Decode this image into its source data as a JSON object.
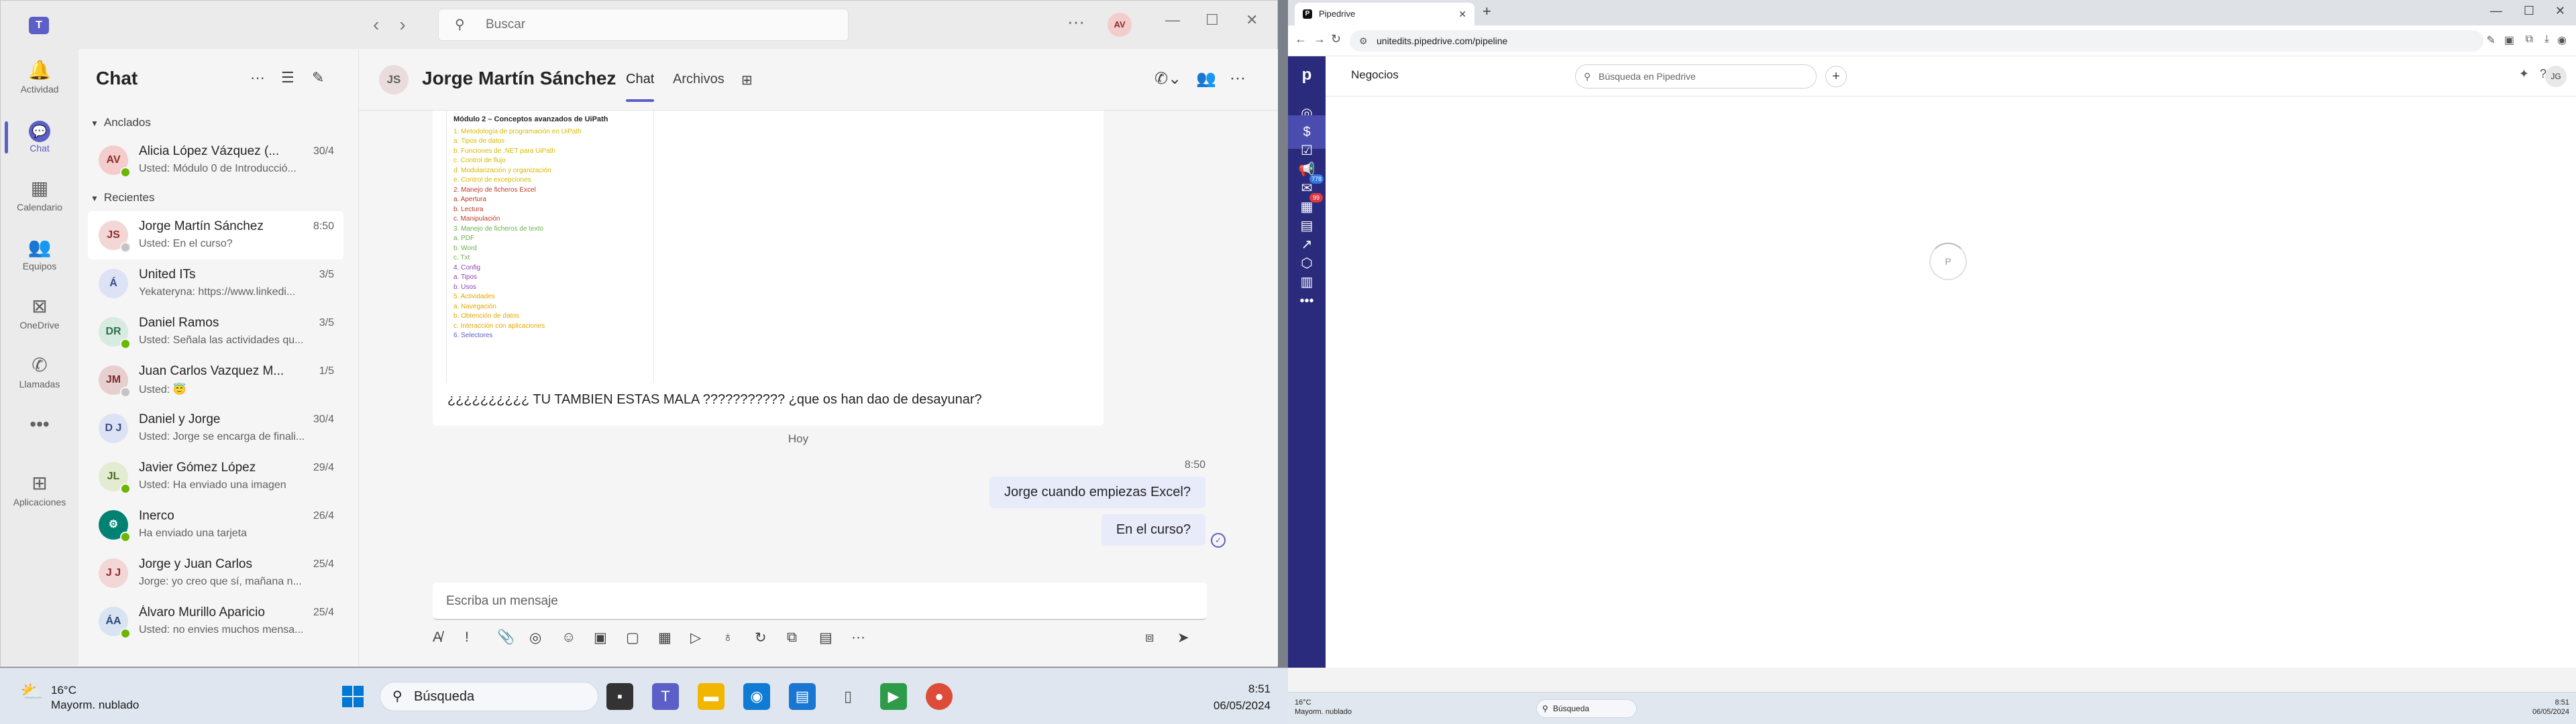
{
  "teams": {
    "search_placeholder": "Buscar",
    "user_initials": "AV",
    "rail": [
      {
        "label": "Actividad",
        "icon": "bell-icon",
        "glyph": "🔔"
      },
      {
        "label": "Chat",
        "icon": "chat-icon",
        "glyph": "💬"
      },
      {
        "label": "Calendario",
        "icon": "calendar-icon",
        "glyph": "▦"
      },
      {
        "label": "Equipos",
        "icon": "teams-icon",
        "glyph": "👥"
      },
      {
        "label": "OneDrive",
        "icon": "onedrive-icon",
        "glyph": "⊠"
      },
      {
        "label": "Llamadas",
        "icon": "phone-icon",
        "glyph": "✆"
      },
      {
        "label": "",
        "icon": "more-icon",
        "glyph": "•••"
      },
      {
        "label": "Aplicaciones",
        "icon": "apps-icon",
        "glyph": "⊞"
      }
    ],
    "chat_title": "Chat",
    "pinned_label": "Anclados",
    "recent_label": "Recientes",
    "pinned": [
      {
        "initials": "AV",
        "name": "Alicia López Vázquez (...",
        "date": "30/4",
        "preview": "Usted: Módulo 0 de Introducció...",
        "avatar_bg": "#f4cccc",
        "avatar_fg": "#8a2b2b",
        "status": "#6bb700"
      }
    ],
    "recent": [
      {
        "initials": "JS",
        "name": "Jorge Martín Sánchez",
        "date": "8:50",
        "preview": "Usted: En el curso?",
        "avatar_bg": "#f3d6d6",
        "avatar_fg": "#8a2b2b",
        "status": "#c4c4c4",
        "selected": true
      },
      {
        "initials": "Á",
        "name": "United ITs",
        "date": "3/5",
        "preview": "Yekateryna: https://www.linkedi...",
        "avatar_bg": "#dde3f5",
        "avatar_fg": "#3a4a8a",
        "status": ""
      },
      {
        "initials": "DR",
        "name": "Daniel Ramos",
        "date": "3/5",
        "preview": "Usted: Señala las actividades qu...",
        "avatar_bg": "#d7ebe1",
        "avatar_fg": "#2f6f4a",
        "status": "#6bb700"
      },
      {
        "initials": "JM",
        "name": "Juan Carlos Vazquez M...",
        "date": "1/5",
        "preview": "Usted: 😇",
        "avatar_bg": "#e8cfcf",
        "avatar_fg": "#7a2b2b",
        "status": "#c4c4c4"
      },
      {
        "initials": "D J",
        "name": "Daniel y Jorge",
        "date": "30/4",
        "preview": "Usted: Jorge se encarga de finali...",
        "avatar_bg": "#dde3f5",
        "avatar_fg": "#3a4a8a",
        "status": ""
      },
      {
        "initials": "JL",
        "name": "Javier Gómez López",
        "date": "29/4",
        "preview": "Usted: Ha enviado una imagen",
        "avatar_bg": "#e3ecd3",
        "avatar_fg": "#4a6a1f",
        "status": "#6bb700"
      },
      {
        "initials": "⚙",
        "name": "Inerco",
        "date": "26/4",
        "preview": "Ha enviado una tarjeta",
        "avatar_bg": "#008272",
        "avatar_fg": "#ffffff",
        "status": "#6bb700"
      },
      {
        "initials": "J J",
        "name": "Jorge y Juan Carlos",
        "date": "25/4",
        "preview": "Jorge: yo creo que sí, mañana n...",
        "avatar_bg": "#f3d6d6",
        "avatar_fg": "#8a2b2b",
        "status": ""
      },
      {
        "initials": "ÁA",
        "name": "Álvaro Murillo Aparicio",
        "date": "25/4",
        "preview": "Usted: no envies muchos mensa...",
        "avatar_bg": "#d9e4f2",
        "avatar_fg": "#2b4a7a",
        "status": "#6bb700"
      }
    ],
    "conversation": {
      "initials": "JS",
      "name": "Jorge Martín Sánchez",
      "tabs": [
        "Chat",
        "Archivos"
      ],
      "doc_title": "Módulo 2 – Conceptos avanzados de UiPath",
      "doc_lines": [
        {
          "text": "1.   Metodología de programación en UiPath",
          "color": "#d9b800"
        },
        {
          "text": "      a.   Tipos de datos",
          "color": "#d9b800"
        },
        {
          "text": "      b.   Funciones de .NET para UiPath",
          "color": "#d9b800"
        },
        {
          "text": "      c.   Control de flujo",
          "color": "#d9b800"
        },
        {
          "text": "      d.   Modularización y organización",
          "color": "#d9b800"
        },
        {
          "text": "      e.   Control de excepciones",
          "color": "#d9b800"
        },
        {
          "text": "2.   Manejo de ficheros Excel",
          "color": "#c0392b"
        },
        {
          "text": "      a.   Apertura",
          "color": "#c0392b"
        },
        {
          "text": "      b.   Lectura",
          "color": "#c0392b"
        },
        {
          "text": "      c.   Manipulación",
          "color": "#c0392b"
        },
        {
          "text": "3.   Manejo de ficheros de texto",
          "color": "#6ab04c"
        },
        {
          "text": "      a.   PDF",
          "color": "#6ab04c"
        },
        {
          "text": "      b.   Word",
          "color": "#6ab04c"
        },
        {
          "text": "      c.   Txt",
          "color": "#6ab04c"
        },
        {
          "text": "4.   Config",
          "color": "#8e44ad"
        },
        {
          "text": "      a.   Tipos",
          "color": "#8e44ad"
        },
        {
          "text": "      b.   Usos",
          "color": "#8e44ad"
        },
        {
          "text": "5.   Actividades",
          "color": "#e6a700"
        },
        {
          "text": "      a.   Navegación",
          "color": "#e6a700"
        },
        {
          "text": "      b.   Obtención de datos",
          "color": "#e6a700"
        },
        {
          "text": "      c.   Interacción con aplicaciones",
          "color": "#e6a700"
        },
        {
          "text": "6.   Selectores",
          "color": "#5b5fc7"
        }
      ],
      "incoming_message": "¿¿¿¿¿¿¿¿¿¿ TU TAMBIEN ESTAS MALA ??????????? ¿que os han dao de desayunar?",
      "day_divider": "Hoy",
      "out_time": "8:50",
      "outgoing": [
        "Jorge cuando empiezas Excel?",
        "En el curso?"
      ],
      "compose_placeholder": "Escriba un mensaje"
    },
    "taskbar": {
      "temp": "16°C",
      "weather": "Mayorm. nublado",
      "search": "Búsqueda",
      "time": "8:51",
      "date": "06/05/2024"
    }
  },
  "browser": {
    "tab_title": "Pipedrive",
    "url": "unitedits.pipedrive.com/pipeline",
    "pipedrive": {
      "logo": "p",
      "section_title": "Negocios",
      "search_placeholder": "Búsqueda en Pipedrive",
      "mail_badge": "778",
      "activity_badge": "99",
      "notif_badge": "9+",
      "user_initials": "JG",
      "loader_letter": "P"
    },
    "taskbar": {
      "temp": "16°C",
      "weather": "Mayorm. nublado",
      "search": "Búsqueda",
      "time": "8:51",
      "date": "06/05/2024"
    }
  }
}
